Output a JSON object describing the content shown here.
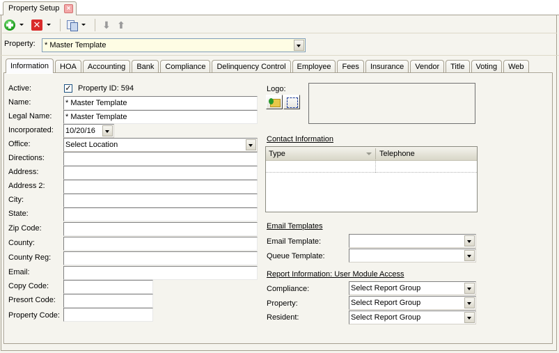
{
  "window": {
    "doc_tab_title": "Property Setup"
  },
  "toolbar": {
    "buttons": [
      {
        "name": "add",
        "icon": "add-icon",
        "has_dropdown": true
      },
      {
        "name": "delete",
        "icon": "delete-icon",
        "has_dropdown": true
      },
      {
        "name": "copy",
        "icon": "copy-icon",
        "has_dropdown": true
      },
      {
        "name": "move-down",
        "icon": "arrow-down-icon",
        "has_dropdown": false
      },
      {
        "name": "move-up",
        "icon": "arrow-up-icon",
        "has_dropdown": false
      }
    ]
  },
  "property_selector": {
    "label": "Property:",
    "value": "* Master Template"
  },
  "tabs": [
    {
      "label": "Information",
      "active": true
    },
    {
      "label": "HOA"
    },
    {
      "label": "Accounting"
    },
    {
      "label": "Bank"
    },
    {
      "label": "Compliance"
    },
    {
      "label": "Delinquency Control"
    },
    {
      "label": "Employee"
    },
    {
      "label": "Fees"
    },
    {
      "label": "Insurance"
    },
    {
      "label": "Vendor"
    },
    {
      "label": "Title"
    },
    {
      "label": "Voting"
    },
    {
      "label": "Web"
    }
  ],
  "info": {
    "active_label": "Active:",
    "active_checked": true,
    "property_id": "Property ID: 594",
    "name_label": "Name:",
    "name_value": "* Master Template",
    "legal_name_label": "Legal Name:",
    "legal_name_value": "* Master Template",
    "incorporated_label": "Incorporated:",
    "incorporated_value": "10/20/16",
    "office_label": "Office:",
    "office_value": "Select Location",
    "directions_label": "Directions:",
    "directions_value": "",
    "address_label": "Address:",
    "address_value": "",
    "address2_label": "Address 2:",
    "address2_value": "",
    "city_label": "City:",
    "city_value": "",
    "state_label": "State:",
    "state_value": "",
    "zip_label": "Zip Code:",
    "zip_value": "",
    "county_label": "County:",
    "county_value": "",
    "county_reg_label": "County Reg:",
    "county_reg_value": "",
    "email_label": "Email:",
    "email_value": "",
    "copy_code_label": "Copy Code:",
    "copy_code_value": "",
    "presort_code_label": "Presort Code:",
    "presort_code_value": "",
    "property_code_label": "Property Code:",
    "property_code_value": ""
  },
  "logo": {
    "label": "Logo:"
  },
  "contact": {
    "title": "Contact Information",
    "columns": [
      "Type",
      "Telephone"
    ],
    "rows": []
  },
  "email_templates": {
    "title": "Email Templates",
    "email_template_label": "Email Template:",
    "email_template_value": "",
    "queue_template_label": "Queue Template:",
    "queue_template_value": ""
  },
  "report_info": {
    "title": "Report Information: User Module Access",
    "compliance_label": "Compliance:",
    "compliance_value": "Select Report Group",
    "property_label": "Property:",
    "property_value": "Select Report Group",
    "resident_label": "Resident:",
    "resident_value": "Select Report Group"
  }
}
